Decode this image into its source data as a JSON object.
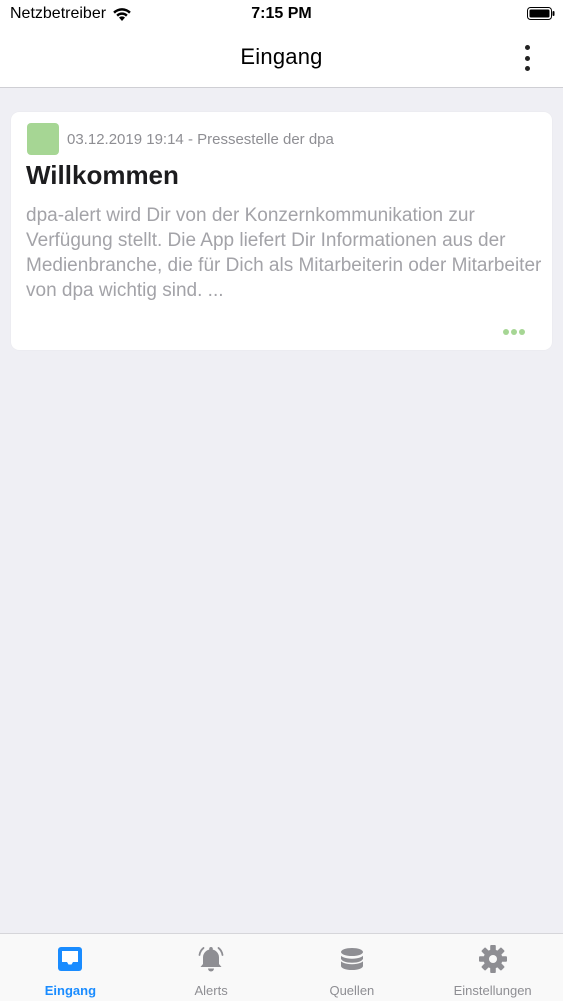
{
  "status_bar": {
    "carrier": "Netzbetreiber",
    "time": "7:15 PM"
  },
  "nav": {
    "title": "Eingang"
  },
  "inbox": {
    "items": [
      {
        "meta": "03.12.2019 19:14 - Pressestelle der dpa",
        "title": "Willkommen",
        "excerpt": "dpa-alert wird Dir von der Konzernkommunikation zur Verfügung stellt. Die App liefert Dir Informationen aus der Medienbranche, die für Dich als Mitarbeiterin oder Mitarbeiter von dpa wichtig sind. ...",
        "badge_color": "#a6d694"
      }
    ]
  },
  "tabs": [
    {
      "label": "Eingang",
      "icon": "inbox-icon",
      "active": true
    },
    {
      "label": "Alerts",
      "icon": "bell-icon",
      "active": false
    },
    {
      "label": "Quellen",
      "icon": "database-icon",
      "active": false
    },
    {
      "label": "Einstellungen",
      "icon": "gear-icon",
      "active": false
    }
  ],
  "colors": {
    "accent": "#1a8cff",
    "inactive": "#8e8e93",
    "background": "#efeff4"
  }
}
